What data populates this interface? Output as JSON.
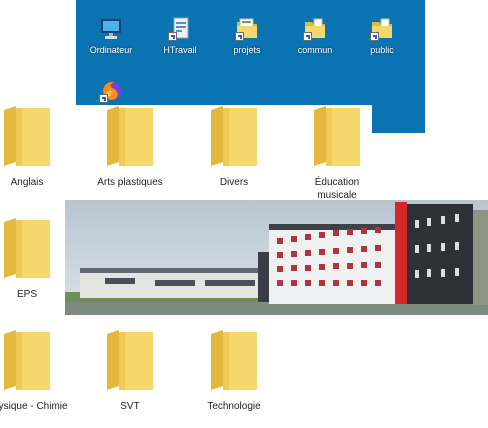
{
  "desktop": {
    "icons": [
      {
        "label": "Ordinateur",
        "icon": "computer-icon"
      },
      {
        "label": "HTravail",
        "icon": "shortcut-document-icon"
      },
      {
        "label": "projets",
        "icon": "shortcut-folder-icon"
      },
      {
        "label": "commun",
        "icon": "shortcut-folder-icon"
      },
      {
        "label": "public",
        "icon": "shortcut-folder-icon"
      },
      {
        "label": "",
        "icon": "firefox-shortcut-icon"
      }
    ],
    "background": "#0a73b2"
  },
  "folders": [
    {
      "label": "Anglais"
    },
    {
      "label": "Arts plastiques"
    },
    {
      "label": "Divers"
    },
    {
      "label": "Éducation musicale"
    },
    {
      "label": "EPS"
    },
    {
      "label": "Physique - Chimie"
    },
    {
      "label": "SVT"
    },
    {
      "label": "Technologie"
    }
  ],
  "photo": {
    "subject": "school-building-photo"
  },
  "colors": {
    "folder": "#f5d76b",
    "folder_dark": "#e5b83d",
    "accent_red": "#d6262a"
  }
}
